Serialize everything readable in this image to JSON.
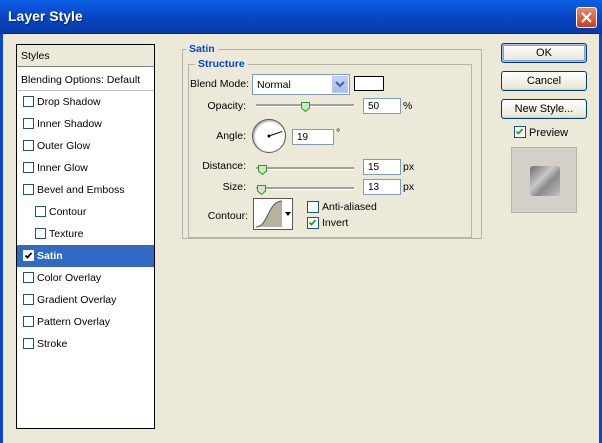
{
  "window": {
    "title": "Layer Style"
  },
  "styles_list": {
    "header": "Styles",
    "items": [
      {
        "label": "Blending Options: Default",
        "checkbox": false,
        "checked": false,
        "indent": false
      },
      {
        "label": "Drop Shadow",
        "checkbox": true,
        "checked": false,
        "indent": false
      },
      {
        "label": "Inner Shadow",
        "checkbox": true,
        "checked": false,
        "indent": false
      },
      {
        "label": "Outer Glow",
        "checkbox": true,
        "checked": false,
        "indent": false
      },
      {
        "label": "Inner Glow",
        "checkbox": true,
        "checked": false,
        "indent": false
      },
      {
        "label": "Bevel and Emboss",
        "checkbox": true,
        "checked": false,
        "indent": false
      },
      {
        "label": "Contour",
        "checkbox": true,
        "checked": false,
        "indent": true
      },
      {
        "label": "Texture",
        "checkbox": true,
        "checked": false,
        "indent": true
      },
      {
        "label": "Satin",
        "checkbox": true,
        "checked": true,
        "indent": false,
        "selected": true
      },
      {
        "label": "Color Overlay",
        "checkbox": true,
        "checked": false,
        "indent": false
      },
      {
        "label": "Gradient Overlay",
        "checkbox": true,
        "checked": false,
        "indent": false
      },
      {
        "label": "Pattern Overlay",
        "checkbox": true,
        "checked": false,
        "indent": false
      },
      {
        "label": "Stroke",
        "checkbox": true,
        "checked": false,
        "indent": false
      }
    ]
  },
  "satin": {
    "group_title": "Satin",
    "structure_title": "Structure",
    "blend_mode": {
      "label": "Blend Mode:",
      "value": "Normal",
      "color": "#ffffff"
    },
    "opacity": {
      "label": "Opacity:",
      "value": "50",
      "unit": "%",
      "fraction": 0.5
    },
    "angle": {
      "label": "Angle:",
      "value": "19",
      "unit": "°"
    },
    "distance": {
      "label": "Distance:",
      "value": "15",
      "unit": "px",
      "fraction": 0.06
    },
    "size": {
      "label": "Size:",
      "value": "13",
      "unit": "px",
      "fraction": 0.05
    },
    "contour": {
      "label": "Contour:"
    },
    "anti_aliased": {
      "label": "Anti-aliased",
      "checked": false
    },
    "invert": {
      "label": "Invert",
      "checked": true
    }
  },
  "buttons": {
    "ok": "OK",
    "cancel": "Cancel",
    "new_style": "New Style..."
  },
  "preview": {
    "label": "Preview",
    "checked": true
  },
  "colors": {
    "titlebar": "#0848c8",
    "selection": "#316ac5",
    "legend": "#0046d5"
  }
}
